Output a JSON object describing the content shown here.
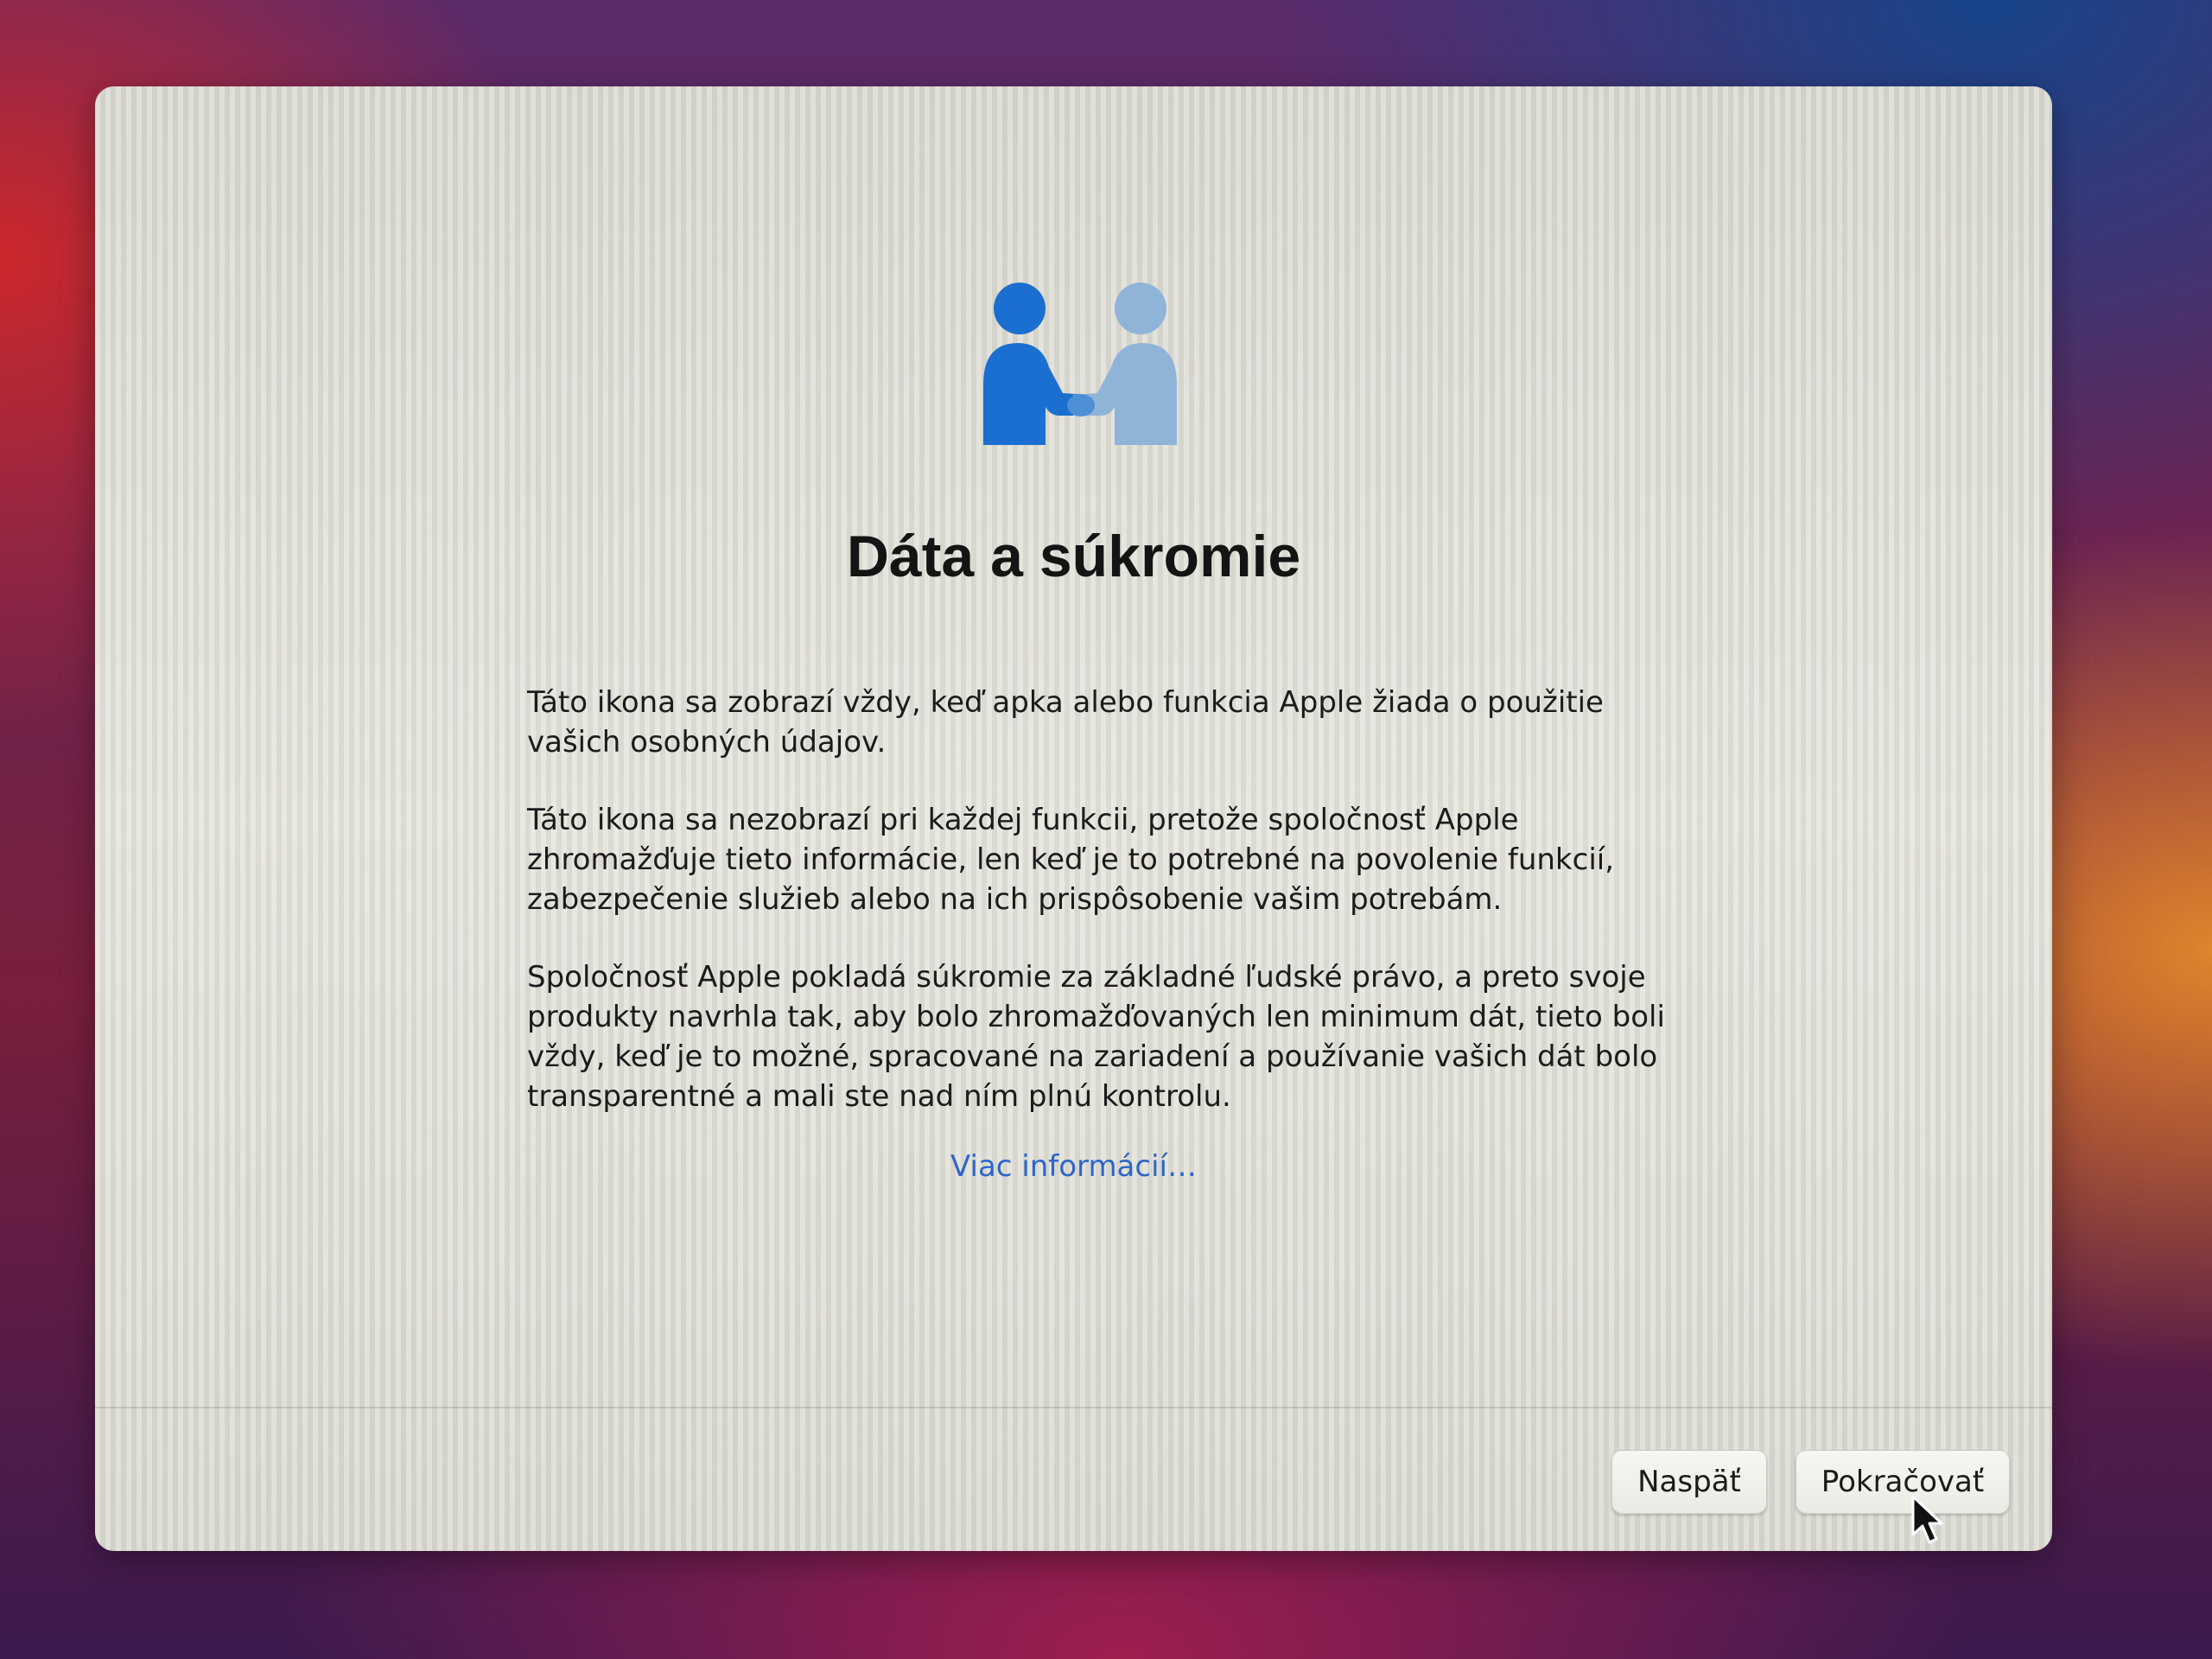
{
  "dialog": {
    "title": "Dáta a súkromie",
    "icon": "privacy-handshake-icon",
    "paragraphs": [
      "Táto ikona sa zobrazí vždy, keď apka alebo funkcia Apple žiada o použitie vašich osobných údajov.",
      "Táto ikona sa nezobrazí pri každej funkcii, pretože spoločnosť Apple zhromažďuje tieto informácie, len keď je to potrebné na povolenie funkcií, zabezpečenie služieb alebo na ich prispôsobenie vašim potrebám.",
      "Spoločnosť Apple pokladá súkromie za základné ľudské právo, a preto svoje produkty navrhla tak, aby bolo zhromažďovaných len minimum dát, tieto boli vždy, keď je to možné, spracované na zariadení a používanie vašich dát bolo transparentné a mali ste nad ním plnú kontrolu."
    ],
    "more_link": "Viac informácií…"
  },
  "buttons": {
    "back_label": "Naspäť",
    "continue_label": "Pokračovať"
  },
  "colors": {
    "link": "#2c66c9",
    "icon_primary": "#1b6fd1",
    "icon_secondary": "#8fb4d8"
  }
}
